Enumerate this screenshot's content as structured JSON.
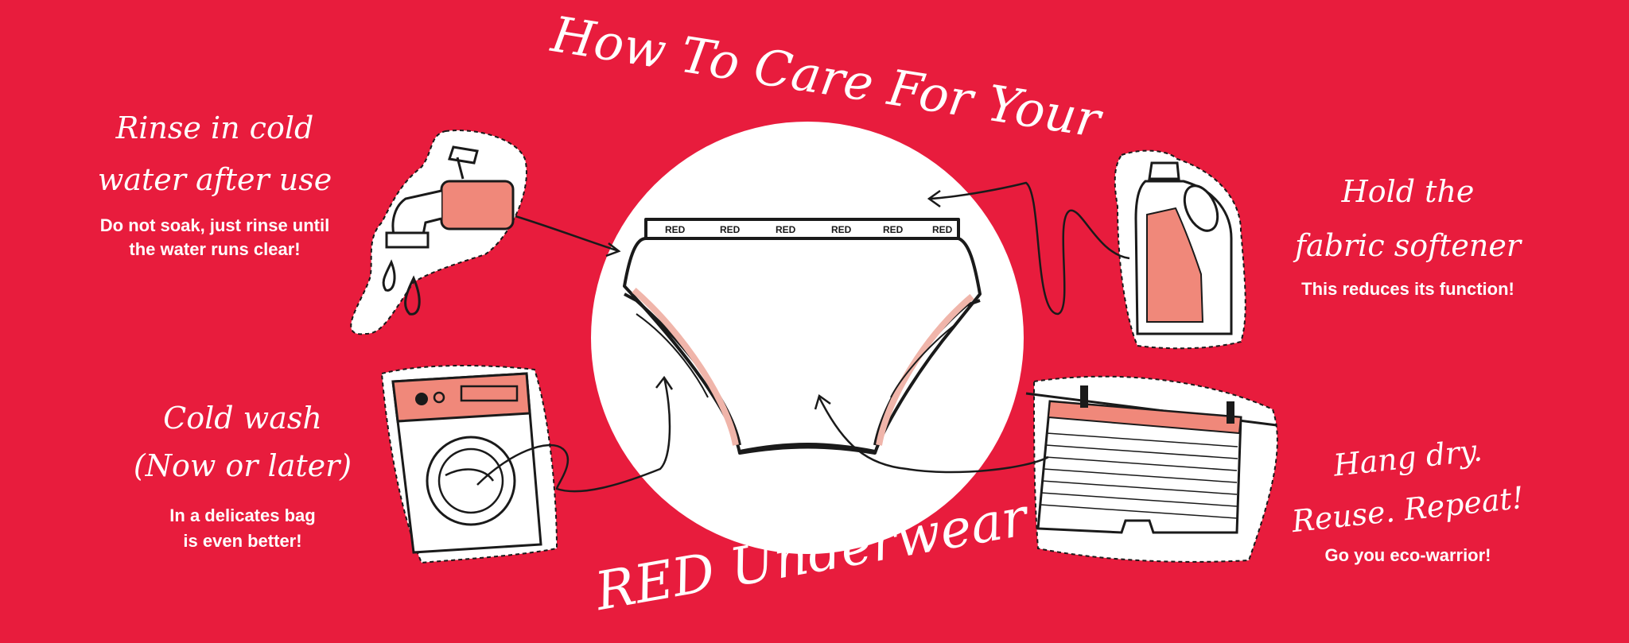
{
  "title": {
    "top": "How To Care For Your",
    "bottom": "RED Underwear"
  },
  "steps": [
    {
      "heading_1": "Rinse in cold",
      "heading_2": "water after use",
      "note_1": "Do not soak, just rinse until",
      "note_2": "the water runs clear!"
    },
    {
      "heading_1": "Cold wash",
      "heading_2": "(Now or later)",
      "note_1": "In a delicates bag",
      "note_2": "is even better!"
    },
    {
      "heading_1": "Hold the",
      "heading_2": "fabric softener",
      "note_1": "This reduces its function!"
    },
    {
      "heading_1": "Hang dry.",
      "heading_2": "Reuse. Repeat!",
      "note_1": "Go you eco-warrior!"
    }
  ],
  "waistband_text": "RED",
  "colors": {
    "background": "#E81C3D",
    "accent": "#F0887A",
    "ink": "#1a1a1a",
    "white": "#ffffff"
  }
}
